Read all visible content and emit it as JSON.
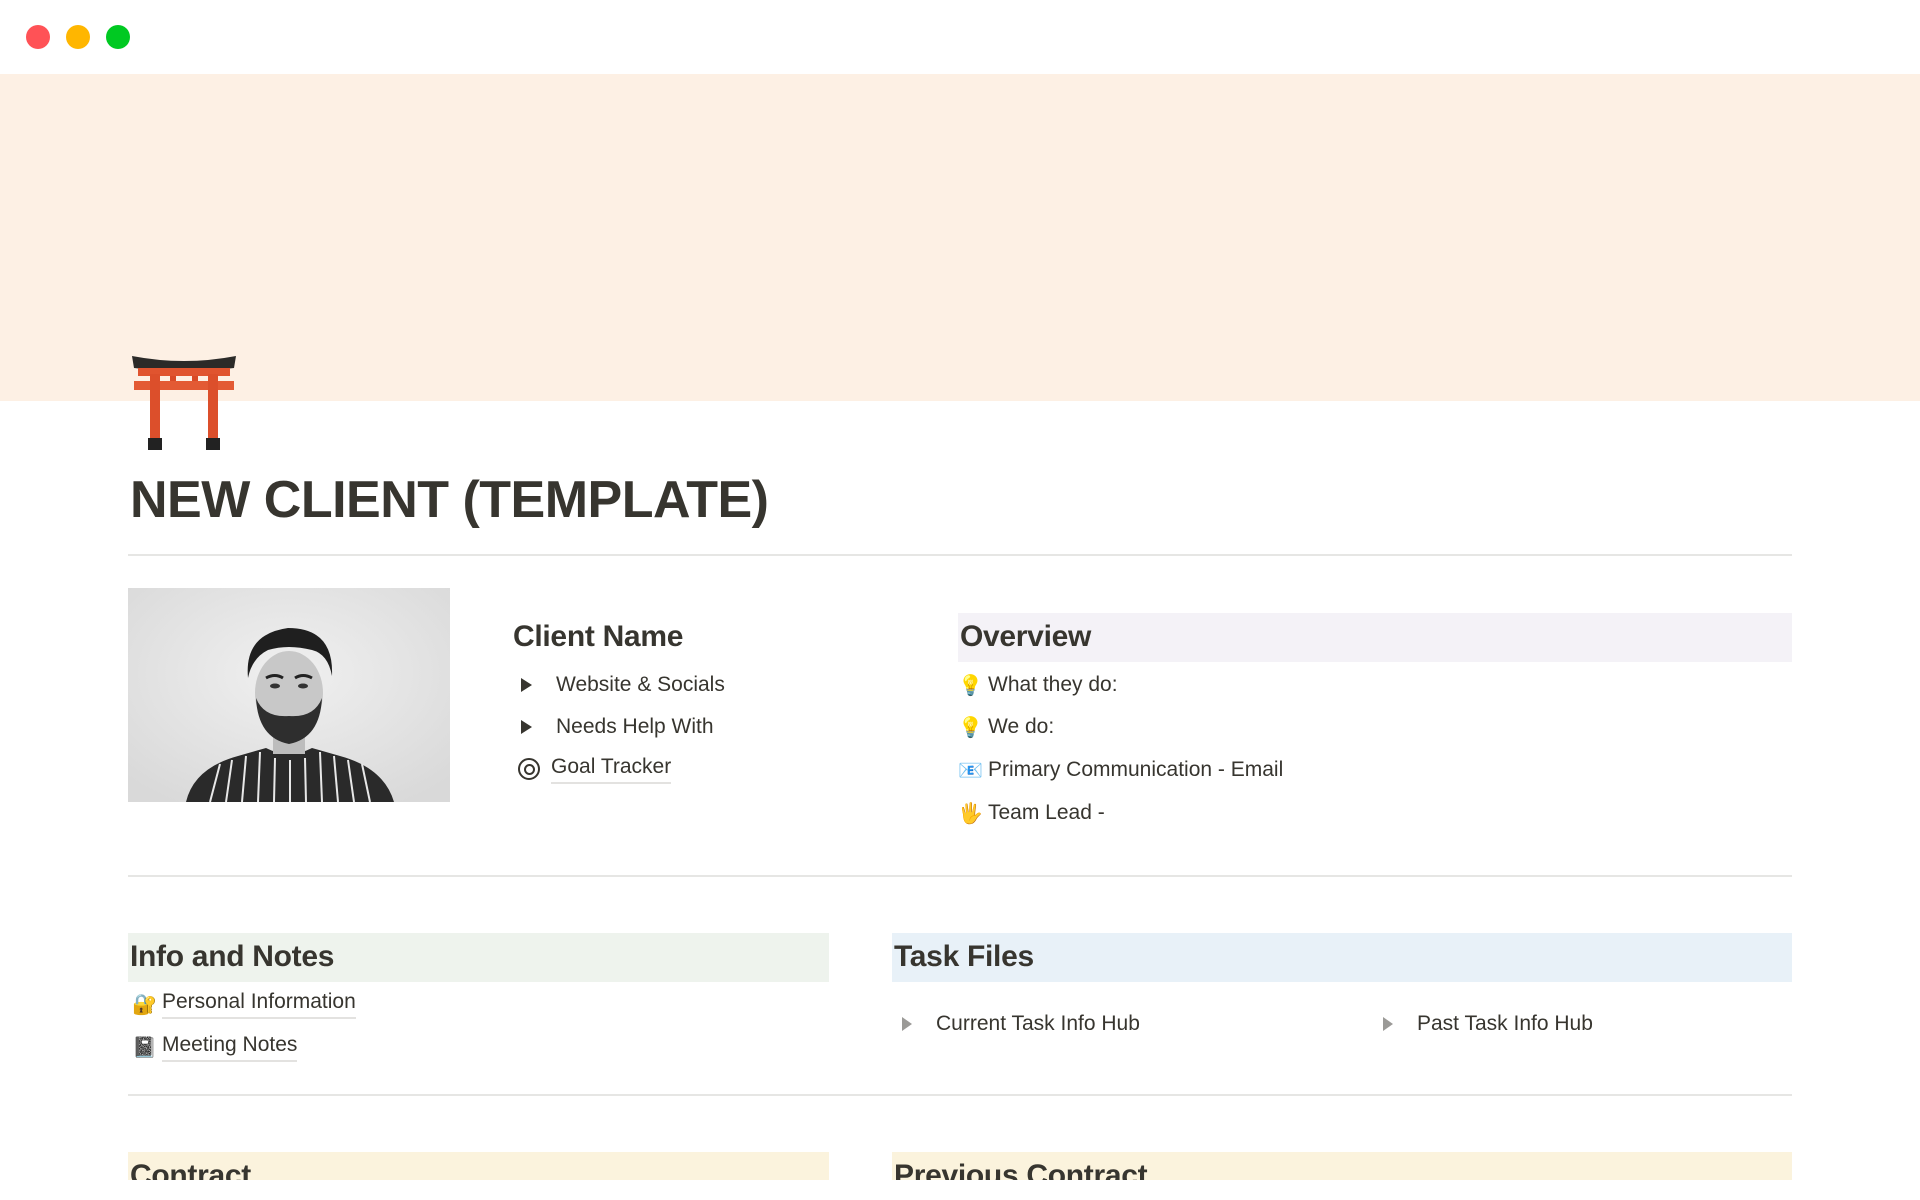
{
  "window": {
    "controls": [
      "close",
      "minimize",
      "maximize"
    ]
  },
  "colors": {
    "cover": "#FDF0E4",
    "overview_bg": "#F4F2F7",
    "info_bg": "#EEF3ED",
    "task_bg": "#E8F1F8",
    "contract_bg": "#FBF3DD",
    "text": "#37352F",
    "divider": "#E6E6E4"
  },
  "page": {
    "icon": "torii-gate-icon",
    "title": "NEW CLIENT (TEMPLATE)"
  },
  "profile": {
    "photo": "client-portrait-photo",
    "heading": "Client Name",
    "items": [
      {
        "type": "toggle",
        "label": "Website & Socials"
      },
      {
        "type": "toggle",
        "label": "Needs Help With"
      },
      {
        "type": "page-link",
        "icon": "target-icon",
        "label": "Goal Tracker"
      }
    ]
  },
  "overview": {
    "heading": "Overview",
    "items": [
      {
        "icon": "light-bulb-icon",
        "glyph": "💡",
        "label": "What they do:"
      },
      {
        "icon": "light-bulb-icon",
        "glyph": "💡",
        "label": "We do:"
      },
      {
        "icon": "email-icon",
        "glyph": "📧",
        "label": "Primary Communication - Email"
      },
      {
        "icon": "raised-hand-icon",
        "glyph": "🖐",
        "label": "Team Lead -"
      }
    ]
  },
  "info_notes": {
    "heading": "Info and Notes",
    "items": [
      {
        "icon": "lock-with-key-icon",
        "glyph": "🔐",
        "label": "Personal Information"
      },
      {
        "icon": "notebook-icon",
        "glyph": "📓",
        "label": "Meeting Notes"
      }
    ]
  },
  "task_files": {
    "heading": "Task Files",
    "items": [
      {
        "label": "Current Task Info Hub"
      },
      {
        "label": "Past Task Info Hub"
      }
    ]
  },
  "contract": {
    "heading": "Contract"
  },
  "previous_contract": {
    "heading": "Previous Contract"
  }
}
